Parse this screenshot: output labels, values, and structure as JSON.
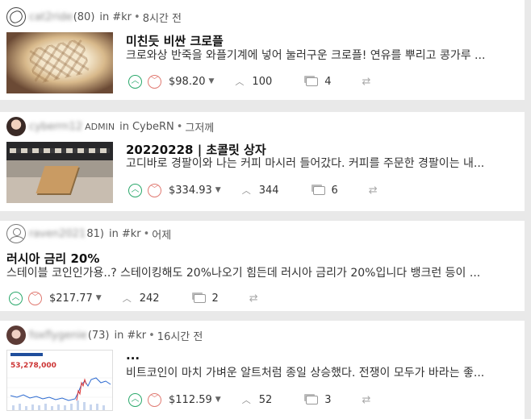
{
  "posts": [
    {
      "username": "cat2ride",
      "reputation": "(80)",
      "in_label": "in",
      "community": "#kr",
      "dot": "•",
      "time": "8시간 전",
      "title": "미친듯 비싼 크로플",
      "body": "크로와상 반죽을 와플기계에 넣어 눌러구운 크로플! 연유를 뿌리고 콩가루 ...",
      "payout": "$98.20",
      "votes": "100",
      "comments": "4"
    },
    {
      "username": "cyberrn12",
      "reputation": "",
      "badge": "ADMIN",
      "in_label": "in",
      "community": "CybeRN",
      "dot": "•",
      "time": "그저께",
      "title": "20220228 | 초콜릿 상자",
      "body": "고디바로 경팔이와 나는 커피 마시러 들어갔다. 커피를 주문한 경팔이는 내...",
      "payout": "$334.93",
      "votes": "344",
      "comments": "6"
    },
    {
      "username": "raven2021",
      "reputation": "81)",
      "in_label": "in",
      "community": "#kr",
      "dot": "•",
      "time": "어제",
      "title": "러시아 금리 20%",
      "body": "스테이블 코인인가용..? 스테이킹해도 20%나오기 힘든데 러시아 금리가 20%입니다 뱅크런 등이 ...",
      "payout": "$217.77",
      "votes": "242",
      "comments": "2"
    },
    {
      "username": "foxflygenie",
      "reputation": "(73)",
      "in_label": "in",
      "community": "#kr",
      "dot": "•",
      "time": "16시간 전",
      "title": "...",
      "body": "비트코인이 마치 가벼운 알트처럼 종일 상승했다. 전쟁이 모두가 바라는 좋...",
      "payout": "$112.59",
      "votes": "52",
      "comments": "3",
      "thumb_price": "53,278,000"
    }
  ],
  "icons": {
    "upvote": "upvote-icon",
    "downvote": "downvote-icon",
    "caret": "caret-down-icon",
    "votes": "chevron-up-icon",
    "comments": "comments-icon",
    "reblog": "reblog-icon"
  },
  "colors": {
    "upvote": "#2aa86b",
    "downvote": "#e07a72",
    "background": "#e9e9e9"
  }
}
